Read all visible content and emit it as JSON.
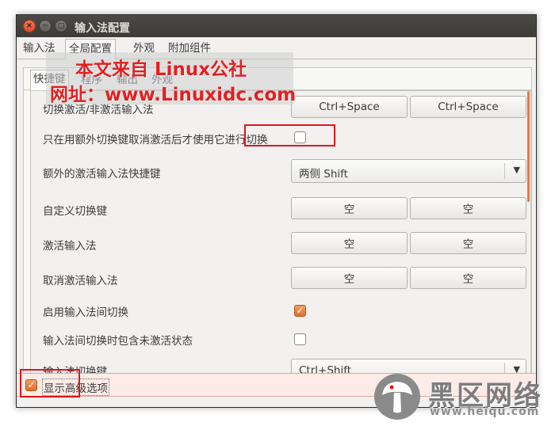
{
  "window": {
    "title": "输入法配置",
    "close_glyph": "×",
    "min_glyph": "−",
    "max_glyph": "□"
  },
  "main_tabs": [
    {
      "label": "输入法"
    },
    {
      "label": "全局配置"
    },
    {
      "label": "外观"
    },
    {
      "label": "附加组件"
    }
  ],
  "sub_tabs": [
    {
      "label": "快捷键"
    },
    {
      "label": "程序"
    },
    {
      "label": "输出"
    },
    {
      "label": "外观"
    }
  ],
  "rows": {
    "toggle": {
      "label": "切换激活/非激活输入法",
      "key1": "Ctrl+Space",
      "key2": "Ctrl+Space"
    },
    "only_extra": {
      "label": "只在用额外切换键取消激活后才使用它进行切换",
      "checked": false
    },
    "extra_key": {
      "label": "额外的激活输入法快捷键",
      "value": "两侧 Shift",
      "arrow": "▼"
    },
    "custom_switch": {
      "label": "自定义切换键",
      "key1": "空",
      "key2": "空"
    },
    "activate": {
      "label": "激活输入法",
      "key1": "空",
      "key2": "空"
    },
    "deactivate": {
      "label": "取消激活输入法",
      "key1": "空",
      "key2": "空"
    },
    "enable_switch": {
      "label": "启用输入法间切换",
      "checked": true,
      "check_glyph": "✓"
    },
    "include_inactive": {
      "label": "输入法间切换时包含未激活状态",
      "checked": false
    },
    "switch_key": {
      "label": "输入法切换键",
      "value": "Ctrl+Shift",
      "arrow": "▼"
    }
  },
  "advanced": {
    "label": "显示高级选项",
    "checked": true,
    "check_glyph": "✓"
  },
  "watermark": {
    "line1": "本文来自 Linux公社",
    "line2": "网址：www.Linuxidc.com"
  },
  "logo": {
    "text": "黑区网络",
    "url": "www.heiqu.com",
    "icon": "mushroom-logo-icon"
  },
  "colors": {
    "accent": "#e2702f",
    "highlight_box": "#e8121a",
    "titlebar": "#3c3b37"
  }
}
